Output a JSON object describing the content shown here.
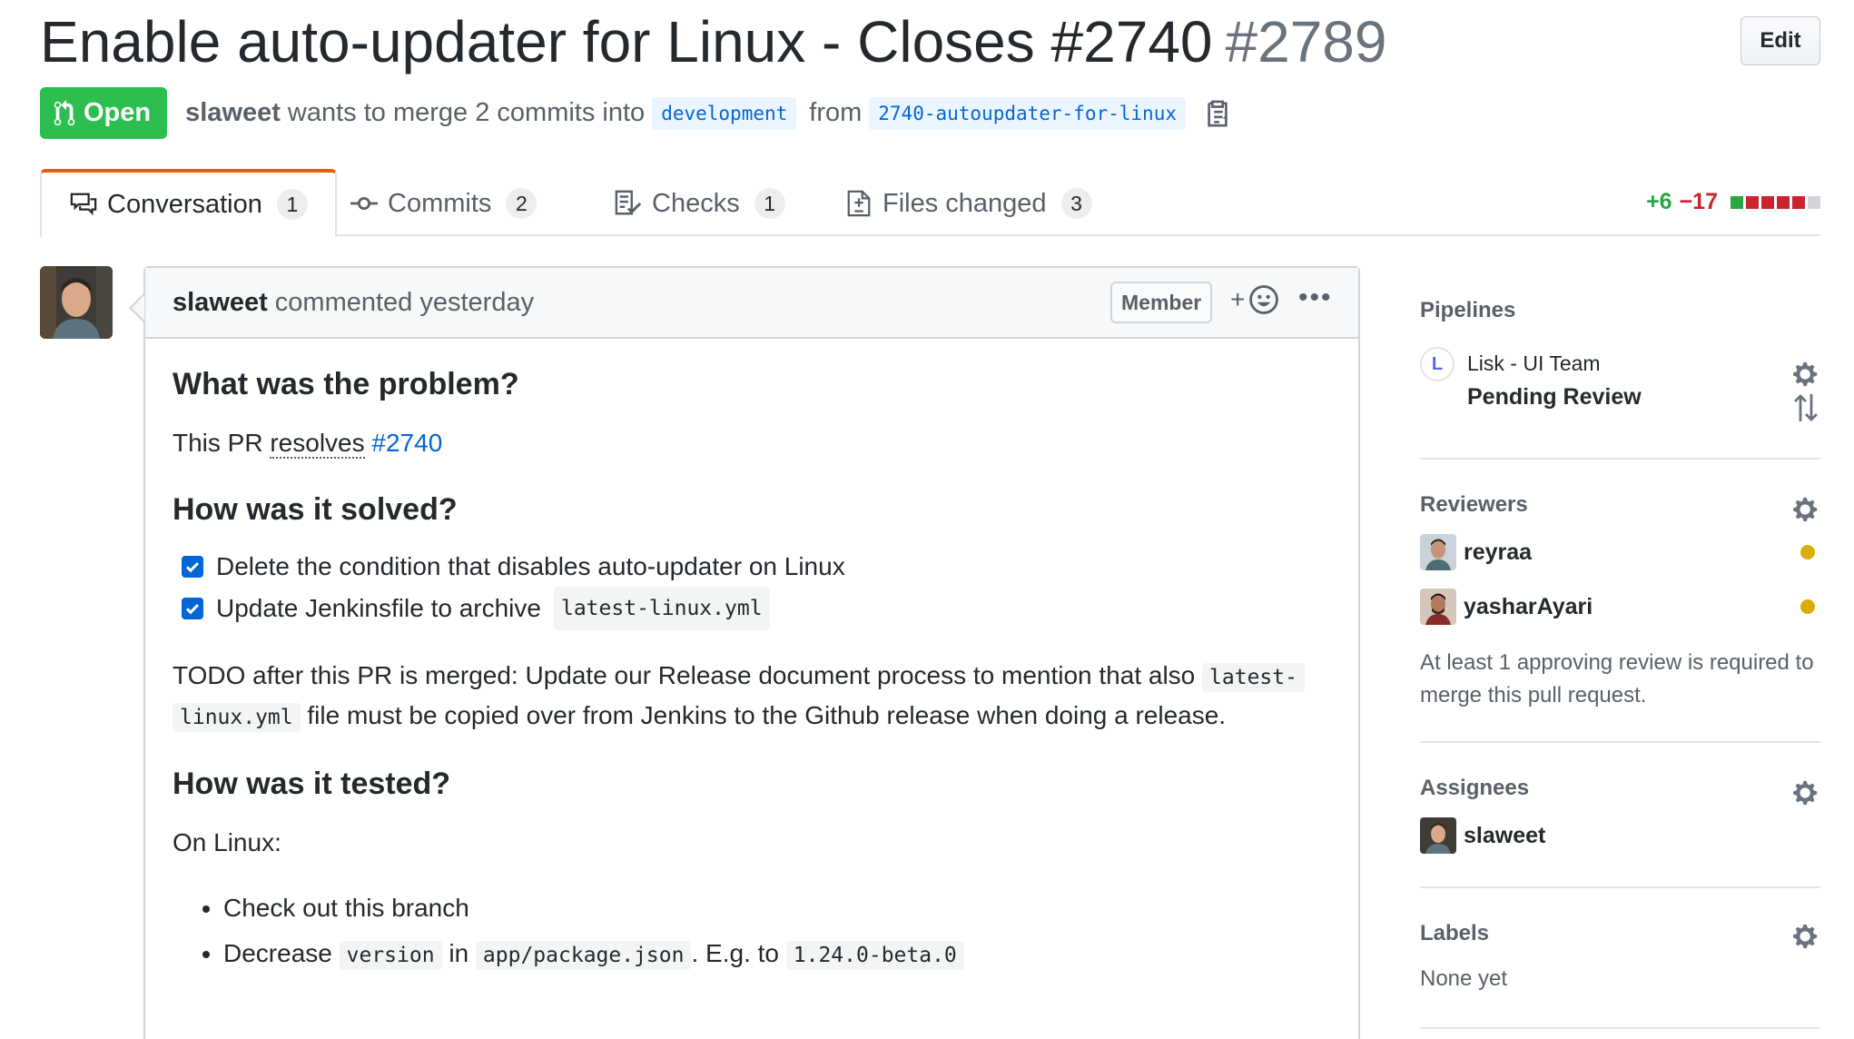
{
  "pr": {
    "title": "Enable auto-updater for Linux - Closes #2740",
    "number": "#2789",
    "edit_label": "Edit",
    "state": "Open",
    "author": "slaweet",
    "merge_text": "wants to merge 2 commits into",
    "base_branch": "development",
    "from_text": "from",
    "head_branch": "2740-autoupdater-for-linux"
  },
  "tabs": [
    {
      "label": "Conversation",
      "count": "1",
      "icon": "comment-discussion-icon"
    },
    {
      "label": "Commits",
      "count": "2",
      "icon": "git-commit-icon"
    },
    {
      "label": "Checks",
      "count": "1",
      "icon": "checklist-icon"
    },
    {
      "label": "Files changed",
      "count": "3",
      "icon": "file-diff-icon"
    }
  ],
  "diffstat": {
    "additions": "+6",
    "deletions": "−17",
    "blocks": [
      "#28a745",
      "#cb2431",
      "#cb2431",
      "#cb2431",
      "#cb2431",
      "#d1d5da"
    ]
  },
  "comment": {
    "author": "slaweet",
    "time": "commented yesterday",
    "role": "Member",
    "h_problem": "What was the problem?",
    "p_resolves_pre": "This PR",
    "p_resolves_word": "resolves",
    "p_resolves_link": "#2740",
    "h_solved": "How was it solved?",
    "tasks": [
      {
        "text": "Delete the condition that disables auto-updater on Linux",
        "code": ""
      },
      {
        "text": "Update Jenkinsfile to archive",
        "code": "latest-linux.yml"
      }
    ],
    "todo_pre": "TODO after this PR is merged: Update our Release document process to mention that also",
    "todo_code_a": "latest-",
    "todo_code_b": "linux.yml",
    "todo_post": "file must be copied over from Jenkins to the Github release when doing a release.",
    "h_tested": "How was it tested?",
    "on_linux": "On Linux:",
    "bullet1": "Check out this branch",
    "bullet2_a": "Decrease",
    "bullet2_code1": "version",
    "bullet2_b": "in",
    "bullet2_code2": "app/package.json",
    "bullet2_c": ". E.g. to",
    "bullet2_code3": "1.24.0-beta.0"
  },
  "sidebar": {
    "pipelines": {
      "heading": "Pipelines",
      "logo_letter": "L",
      "name": "Lisk - UI Team",
      "status": "Pending Review"
    },
    "reviewers": {
      "heading": "Reviewers",
      "people": [
        "reyraa",
        "yasharAyari"
      ],
      "note": "At least 1 approving review is required to merge this pull request."
    },
    "assignees": {
      "heading": "Assignees",
      "people": [
        "slaweet"
      ]
    },
    "labels": {
      "heading": "Labels",
      "value": "None yet"
    }
  },
  "colors": {
    "open": "#2cbe4e",
    "link": "#0366d6",
    "pending": "#dbab09",
    "tab_accent": "#e36209"
  }
}
